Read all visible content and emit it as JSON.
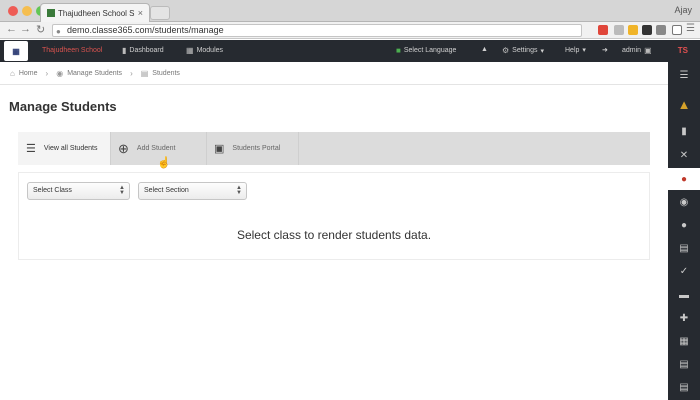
{
  "browser": {
    "tab_title": "Thajudheen School SIS an",
    "tab_close": "×",
    "profile": "Ajay",
    "url": "demo.classe365.com/students/manage"
  },
  "navbar": {
    "school_name": "Thajudheen School",
    "dashboard": "Dashboard",
    "modules": "Modules",
    "select_language": "Select Language",
    "settings": "Settings",
    "help": "Help",
    "admin": "admin",
    "initials": "TS"
  },
  "breadcrumb": {
    "home": "Home",
    "manage_students": "Manage Students",
    "students": "Students"
  },
  "page": {
    "title": "Manage Students"
  },
  "tabs": {
    "view_all": "View all Students",
    "add_student": "Add Student",
    "students_portal": "Students Portal"
  },
  "filters": {
    "class_selected": "Select Class",
    "section_selected": "Select Section"
  },
  "content": {
    "empty_message": "Select class to render students data."
  },
  "icons": {
    "home": "home-icon",
    "dashboard": "bar-chart-icon",
    "modules": "grid-icon",
    "settings": "gear-icon",
    "notifications": "bell-icon",
    "lock": "lock-icon"
  },
  "colors": {
    "navbar_bg": "#262a30",
    "school_name": "#d9534f",
    "active_sidebar": "#c0392b"
  }
}
